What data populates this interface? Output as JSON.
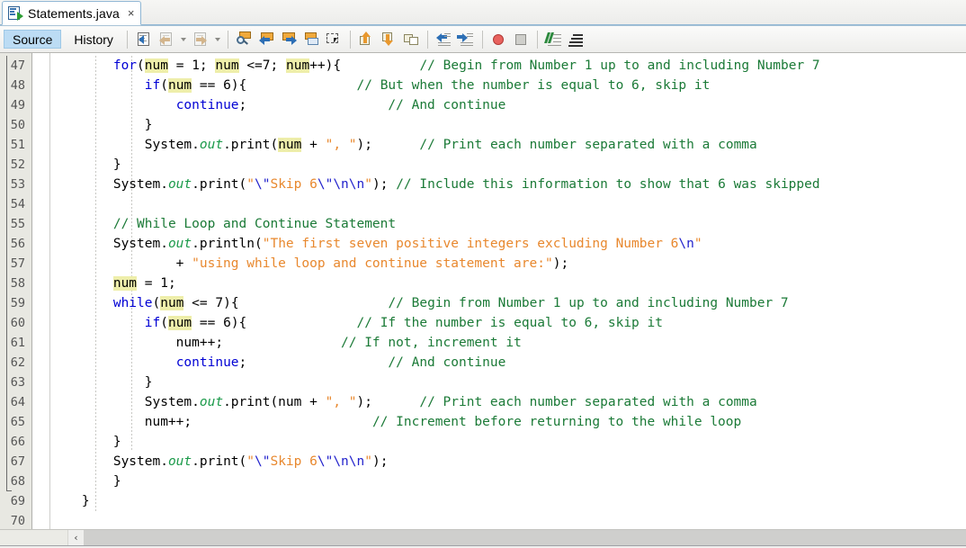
{
  "window": {
    "tab": {
      "title": "Statements.java",
      "icon": "java-file-icon",
      "close": "×"
    }
  },
  "toolbar": {
    "view_tabs": [
      {
        "label": "Source",
        "selected": true
      },
      {
        "label": "History",
        "selected": false
      }
    ],
    "buttons": [
      {
        "name": "last-edit-position",
        "icon": "last-edit-icon"
      },
      {
        "name": "back",
        "icon": "back-arrow-icon"
      },
      {
        "name": "back-dropdown",
        "icon": "chevron-down-icon"
      },
      {
        "name": "forward",
        "icon": "forward-arrow-icon"
      },
      {
        "name": "forward-dropdown",
        "icon": "chevron-down-icon"
      },
      {
        "name": "find-selection",
        "icon": "magnifier-icon"
      },
      {
        "name": "find-previous",
        "icon": "find-previous-icon"
      },
      {
        "name": "find-next",
        "icon": "find-next-icon"
      },
      {
        "name": "toggle-highlight",
        "icon": "highlight-icon"
      },
      {
        "name": "toggle-rectangular-selection",
        "icon": "rect-selection-icon"
      },
      {
        "name": "previous-bookmark",
        "icon": "previous-bookmark-icon"
      },
      {
        "name": "next-bookmark",
        "icon": "next-bookmark-icon"
      },
      {
        "name": "toggle-bookmark",
        "icon": "toggle-bookmark-icon"
      },
      {
        "name": "shift-left",
        "icon": "shift-left-icon"
      },
      {
        "name": "shift-right",
        "icon": "shift-right-icon"
      },
      {
        "name": "start-macro-recording",
        "icon": "record-macro-icon"
      },
      {
        "name": "stop-macro-recording",
        "icon": "stop-macro-icon"
      },
      {
        "name": "inspect-members",
        "icon": "inspect-members-icon"
      },
      {
        "name": "inspect-hierarchy",
        "icon": "inspect-hierarchy-icon"
      }
    ]
  },
  "editor": {
    "first_line_number": 47,
    "scrollbar": {
      "left_arrow": "‹"
    },
    "lines": [
      {
        "n": 47,
        "tokens": [
          {
            "t": "        ",
            "c": ""
          },
          {
            "t": "for",
            "c": "kw"
          },
          {
            "t": "(",
            "c": ""
          },
          {
            "t": "num",
            "c": "hl"
          },
          {
            "t": " = ",
            "c": ""
          },
          {
            "t": "1",
            "c": ""
          },
          {
            "t": "; ",
            "c": ""
          },
          {
            "t": "num",
            "c": "hl"
          },
          {
            "t": " <=",
            "c": ""
          },
          {
            "t": "7",
            "c": ""
          },
          {
            "t": "; ",
            "c": ""
          },
          {
            "t": "num",
            "c": "hl"
          },
          {
            "t": "++){",
            "c": ""
          },
          {
            "t": "          ",
            "c": ""
          },
          {
            "t": "// Begin from Number 1 up to and including Number 7",
            "c": "cm"
          }
        ]
      },
      {
        "n": 48,
        "tokens": [
          {
            "t": "            ",
            "c": ""
          },
          {
            "t": "if",
            "c": "kw"
          },
          {
            "t": "(",
            "c": ""
          },
          {
            "t": "num",
            "c": "hl"
          },
          {
            "t": " == ",
            "c": ""
          },
          {
            "t": "6",
            "c": ""
          },
          {
            "t": "){",
            "c": ""
          },
          {
            "t": "              ",
            "c": ""
          },
          {
            "t": "// But when the number is equal to 6, skip it",
            "c": "cm"
          }
        ]
      },
      {
        "n": 49,
        "tokens": [
          {
            "t": "                ",
            "c": ""
          },
          {
            "t": "continue",
            "c": "kw"
          },
          {
            "t": ";",
            "c": ""
          },
          {
            "t": "                  ",
            "c": ""
          },
          {
            "t": "// And continue",
            "c": "cm"
          }
        ]
      },
      {
        "n": 50,
        "tokens": [
          {
            "t": "            }",
            "c": ""
          }
        ]
      },
      {
        "n": 51,
        "tokens": [
          {
            "t": "            System.",
            "c": ""
          },
          {
            "t": "out",
            "c": "fld"
          },
          {
            "t": ".print(",
            "c": ""
          },
          {
            "t": "num",
            "c": "hl"
          },
          {
            "t": " + ",
            "c": ""
          },
          {
            "t": "\", \"",
            "c": "st"
          },
          {
            "t": ");",
            "c": ""
          },
          {
            "t": "      ",
            "c": ""
          },
          {
            "t": "// Print each number separated with a comma",
            "c": "cm"
          }
        ]
      },
      {
        "n": 52,
        "tokens": [
          {
            "t": "        }",
            "c": ""
          }
        ]
      },
      {
        "n": 53,
        "tokens": [
          {
            "t": "        System.",
            "c": ""
          },
          {
            "t": "out",
            "c": "fld"
          },
          {
            "t": ".print(",
            "c": ""
          },
          {
            "t": "\"",
            "c": "st"
          },
          {
            "t": "\\\"",
            "c": "esc"
          },
          {
            "t": "Skip 6",
            "c": "st"
          },
          {
            "t": "\\\"",
            "c": "esc"
          },
          {
            "t": "\\n\\n",
            "c": "esc"
          },
          {
            "t": "\"",
            "c": "st"
          },
          {
            "t": "); ",
            "c": ""
          },
          {
            "t": "// Include this information to show that 6 was skipped",
            "c": "cm"
          }
        ]
      },
      {
        "n": 54,
        "tokens": []
      },
      {
        "n": 55,
        "tokens": [
          {
            "t": "        ",
            "c": ""
          },
          {
            "t": "// While Loop and Continue Statement",
            "c": "cm"
          }
        ]
      },
      {
        "n": 56,
        "tokens": [
          {
            "t": "        System.",
            "c": ""
          },
          {
            "t": "out",
            "c": "fld"
          },
          {
            "t": ".println(",
            "c": ""
          },
          {
            "t": "\"The first seven positive integers excluding Number 6",
            "c": "st"
          },
          {
            "t": "\\n",
            "c": "esc"
          },
          {
            "t": "\"",
            "c": "st"
          }
        ]
      },
      {
        "n": 57,
        "tokens": [
          {
            "t": "                + ",
            "c": ""
          },
          {
            "t": "\"using while loop and continue statement are:\"",
            "c": "st"
          },
          {
            "t": ");",
            "c": ""
          }
        ]
      },
      {
        "n": 58,
        "tokens": [
          {
            "t": "        ",
            "c": ""
          },
          {
            "t": "num",
            "c": "hl"
          },
          {
            "t": " = ",
            "c": ""
          },
          {
            "t": "1",
            "c": ""
          },
          {
            "t": ";",
            "c": ""
          }
        ]
      },
      {
        "n": 59,
        "tokens": [
          {
            "t": "        ",
            "c": ""
          },
          {
            "t": "while",
            "c": "kw"
          },
          {
            "t": "(",
            "c": ""
          },
          {
            "t": "num",
            "c": "hl"
          },
          {
            "t": " <= ",
            "c": ""
          },
          {
            "t": "7",
            "c": ""
          },
          {
            "t": "){",
            "c": ""
          },
          {
            "t": "                   ",
            "c": ""
          },
          {
            "t": "// Begin from Number 1 up to and including Number 7",
            "c": "cm"
          }
        ]
      },
      {
        "n": 60,
        "tokens": [
          {
            "t": "            ",
            "c": ""
          },
          {
            "t": "if",
            "c": "kw"
          },
          {
            "t": "(",
            "c": ""
          },
          {
            "t": "num",
            "c": "hl"
          },
          {
            "t": " == ",
            "c": ""
          },
          {
            "t": "6",
            "c": ""
          },
          {
            "t": "){",
            "c": ""
          },
          {
            "t": "              ",
            "c": ""
          },
          {
            "t": "// If the number is equal to 6, skip it",
            "c": "cm"
          }
        ]
      },
      {
        "n": 61,
        "tokens": [
          {
            "t": "                num++;",
            "c": ""
          },
          {
            "t": "               ",
            "c": ""
          },
          {
            "t": "// If not, increment it",
            "c": "cm"
          }
        ]
      },
      {
        "n": 62,
        "tokens": [
          {
            "t": "                ",
            "c": ""
          },
          {
            "t": "continue",
            "c": "kw"
          },
          {
            "t": ";",
            "c": ""
          },
          {
            "t": "                  ",
            "c": ""
          },
          {
            "t": "// And continue",
            "c": "cm"
          }
        ]
      },
      {
        "n": 63,
        "tokens": [
          {
            "t": "            }",
            "c": ""
          }
        ]
      },
      {
        "n": 64,
        "tokens": [
          {
            "t": "            System.",
            "c": ""
          },
          {
            "t": "out",
            "c": "fld"
          },
          {
            "t": ".print(num + ",
            "c": ""
          },
          {
            "t": "\", \"",
            "c": "st"
          },
          {
            "t": ");",
            "c": ""
          },
          {
            "t": "      ",
            "c": ""
          },
          {
            "t": "// Print each number separated with a comma",
            "c": "cm"
          }
        ]
      },
      {
        "n": 65,
        "tokens": [
          {
            "t": "            num++;",
            "c": ""
          },
          {
            "t": "                       ",
            "c": ""
          },
          {
            "t": "// Increment before returning to the while loop",
            "c": "cm"
          }
        ]
      },
      {
        "n": 66,
        "tokens": [
          {
            "t": "        }",
            "c": ""
          }
        ]
      },
      {
        "n": 67,
        "tokens": [
          {
            "t": "        System.",
            "c": ""
          },
          {
            "t": "out",
            "c": "fld"
          },
          {
            "t": ".print(",
            "c": ""
          },
          {
            "t": "\"",
            "c": "st"
          },
          {
            "t": "\\\"",
            "c": "esc"
          },
          {
            "t": "Skip 6",
            "c": "st"
          },
          {
            "t": "\\\"",
            "c": "esc"
          },
          {
            "t": "\\n\\n",
            "c": "esc"
          },
          {
            "t": "\"",
            "c": "st"
          },
          {
            "t": ");",
            "c": ""
          }
        ]
      },
      {
        "n": 68,
        "tokens": [
          {
            "t": "        }",
            "c": ""
          }
        ]
      },
      {
        "n": 69,
        "tokens": [
          {
            "t": "    }",
            "c": ""
          }
        ]
      },
      {
        "n": 70,
        "tokens": []
      }
    ]
  },
  "colors": {
    "keyword": "#0000d4",
    "comment": "#1b7a37",
    "string": "#e8882e",
    "escape": "#2222cc",
    "field": "#1b9a4a",
    "highlight": "#eeeeaa",
    "gutter_bg": "#e8e8e2",
    "tab_selected": "#bcdcf4"
  }
}
